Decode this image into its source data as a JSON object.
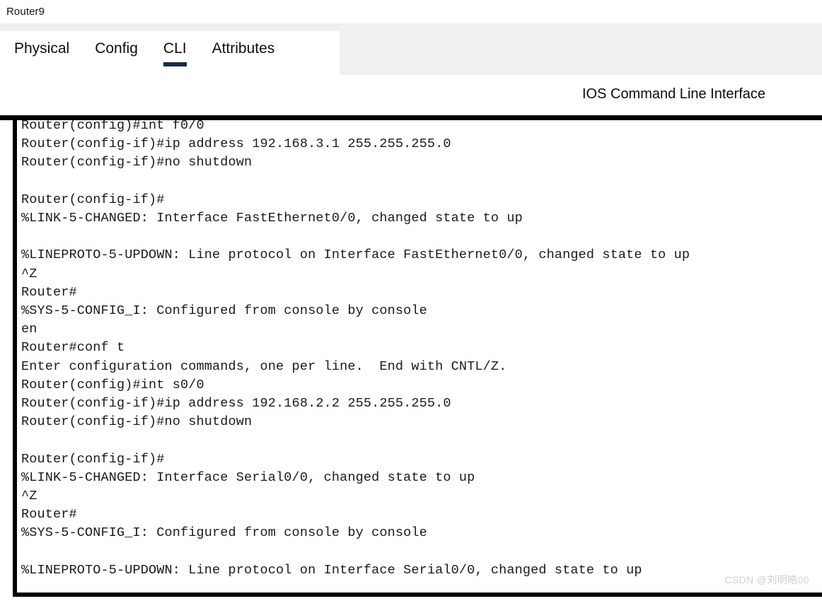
{
  "window": {
    "title": "Router9"
  },
  "tabs": [
    {
      "label": "Physical",
      "active": false
    },
    {
      "label": "Config",
      "active": false
    },
    {
      "label": "CLI",
      "active": true
    },
    {
      "label": "Attributes",
      "active": false
    }
  ],
  "panel": {
    "header_label": "IOS Command Line Interface"
  },
  "terminal": {
    "lines": [
      "Router(config)#int f0/0",
      "Router(config-if)#ip address 192.168.3.1 255.255.255.0",
      "Router(config-if)#no shutdown",
      "",
      "Router(config-if)#",
      "%LINK-5-CHANGED: Interface FastEthernet0/0, changed state to up",
      "",
      "%LINEPROTO-5-UPDOWN: Line protocol on Interface FastEthernet0/0, changed state to up",
      "^Z",
      "Router#",
      "%SYS-5-CONFIG_I: Configured from console by console",
      "en",
      "Router#conf t",
      "Enter configuration commands, one per line.  End with CNTL/Z.",
      "Router(config)#int s0/0",
      "Router(config-if)#ip address 192.168.2.2 255.255.255.0",
      "Router(config-if)#no shutdown",
      "",
      "Router(config-if)#",
      "%LINK-5-CHANGED: Interface Serial0/0, changed state to up",
      "^Z",
      "Router#",
      "%SYS-5-CONFIG_I: Configured from console by console",
      "",
      "%LINEPROTO-5-UPDOWN: Line protocol on Interface Serial0/0, changed state to up"
    ]
  },
  "watermark": {
    "text": "CSDN @刘明皓00"
  },
  "colors": {
    "tab_active_underline": "#16294a",
    "strip_gray": "#f0f0f0",
    "terminal_border": "#000000",
    "terminal_text": "#1a1a1a",
    "watermark": "#d0d0d0"
  }
}
